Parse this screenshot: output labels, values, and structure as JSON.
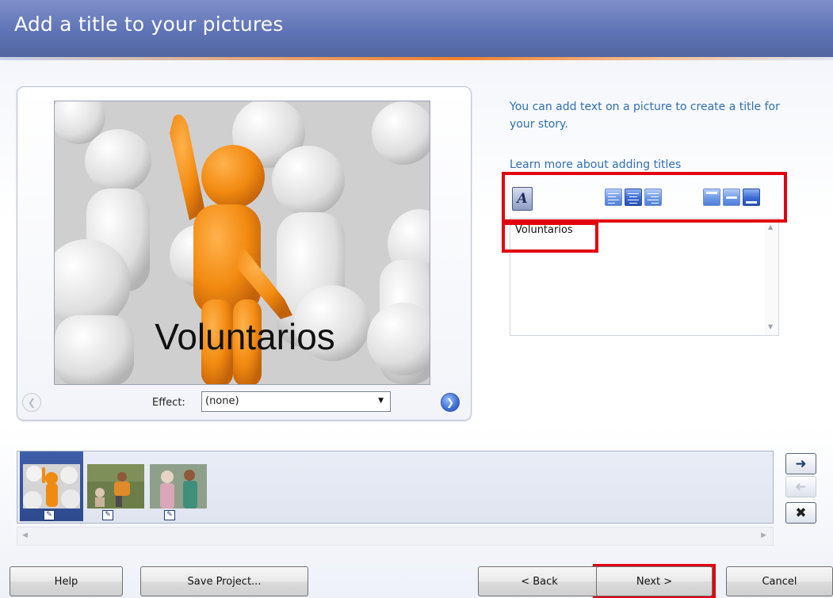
{
  "window": {
    "title": "Add a title to your pictures"
  },
  "preview": {
    "caption": "Voluntarios",
    "effect_label": "Effect:",
    "effect_value": "(none)",
    "prev_icon": "chevron-left-icon",
    "next_icon": "chevron-right-icon"
  },
  "right_panel": {
    "info": "You can add text on a picture to create a title for your story.",
    "learn_link": "Learn more about adding titles",
    "toolbar": {
      "font_button_glyph": "A",
      "text_align": [
        "align-left",
        "align-center",
        "align-right"
      ],
      "text_align_selected": "align-center",
      "vertical_position": [
        "position-top",
        "position-middle",
        "position-bottom"
      ],
      "vertical_position_selected": "position-bottom"
    },
    "title_text": "Voluntarios"
  },
  "filmstrip": {
    "thumbnails": [
      {
        "name": "picture-1",
        "selected": true
      },
      {
        "name": "picture-2",
        "selected": false
      },
      {
        "name": "picture-3",
        "selected": false
      }
    ],
    "side_buttons": [
      "move-right-icon",
      "move-left-icon",
      "delete-icon"
    ]
  },
  "buttons": {
    "help": "Help",
    "save_project": "Save Project...",
    "back": "< Back",
    "next": "Next >",
    "cancel": "Cancel"
  },
  "colors": {
    "header": "#5f74b6",
    "accent_stripe": "#ef7f2c",
    "link_text": "#2f6fb1",
    "highlight_box": "#e2000f"
  }
}
